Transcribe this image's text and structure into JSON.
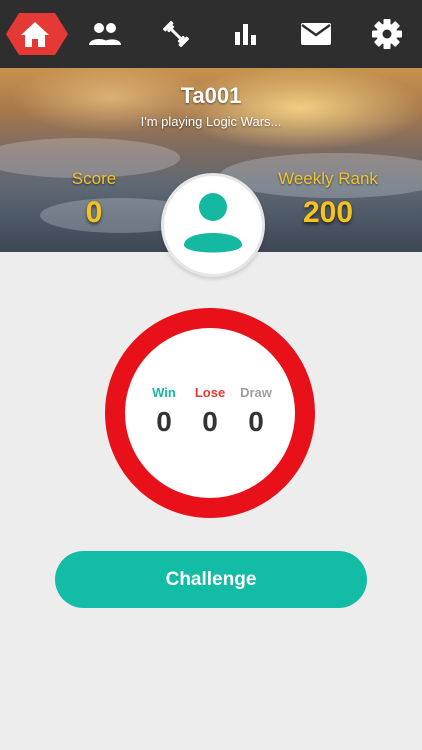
{
  "nav": {
    "items": [
      {
        "icon": "home-icon",
        "active": true
      },
      {
        "icon": "friends-icon",
        "active": false
      },
      {
        "icon": "workout-icon",
        "active": false
      },
      {
        "icon": "stats-icon",
        "active": false
      },
      {
        "icon": "mail-icon",
        "active": false
      },
      {
        "icon": "settings-icon",
        "active": false
      }
    ],
    "active_color": "#e53935",
    "bar_color": "#2e2e2e"
  },
  "profile": {
    "username": "Ta001",
    "status": "I'm playing Logic Wars...",
    "score_label": "Score",
    "score_value": "0",
    "rank_label": "Weekly Rank",
    "rank_value": "200"
  },
  "record": {
    "win_label": "Win",
    "win_value": "0",
    "lose_label": "Lose",
    "lose_value": "0",
    "draw_label": "Draw",
    "draw_value": "0",
    "ring_color": "#e8111a"
  },
  "actions": {
    "challenge_label": "Challenge",
    "accent": "#13bca4"
  }
}
